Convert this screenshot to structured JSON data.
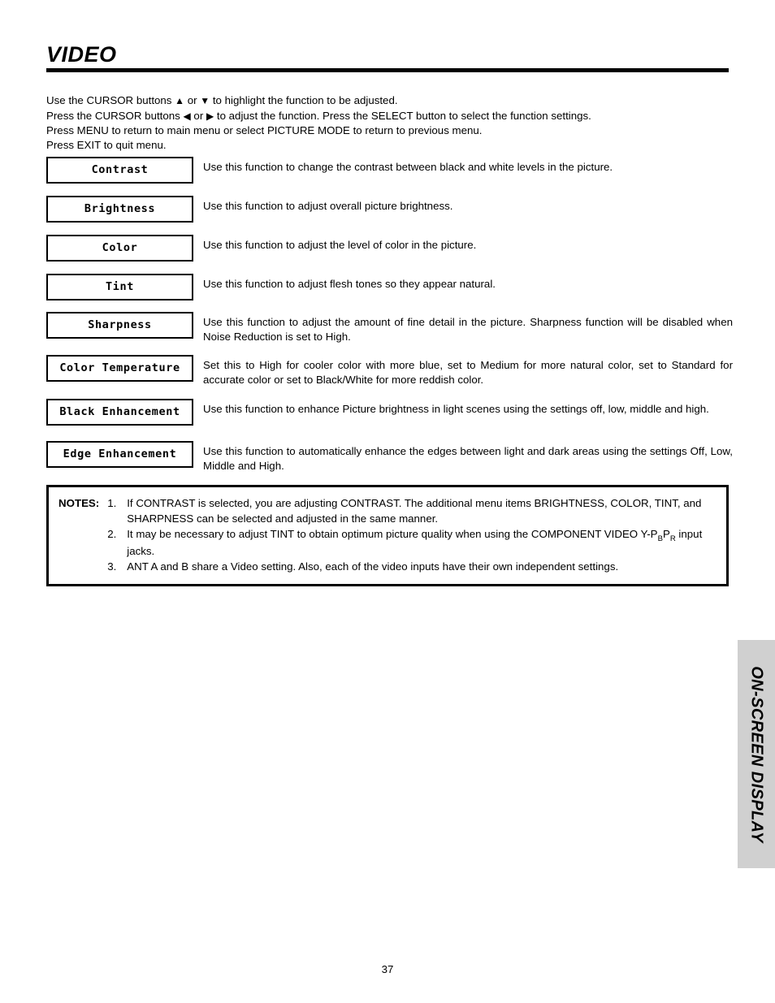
{
  "header": {
    "title": "VIDEO"
  },
  "intro": {
    "line1_a": "Use the CURSOR buttons ",
    "line1_up": "▲",
    "line1_b": " or ",
    "line1_down": "▼",
    "line1_c": " to highlight the function to be adjusted.",
    "line2_a": "Press the CURSOR buttons ",
    "line2_left": "◀",
    "line2_b": " or ",
    "line2_right": "▶",
    "line2_c": " to adjust the function.  Press the SELECT button to select the function settings.",
    "line3": "Press MENU to return to main menu or select PICTURE MODE to return to previous menu.",
    "line4": "Press EXIT to quit menu."
  },
  "functions": [
    {
      "label": "Contrast",
      "description": "Use this function to change the contrast between black and white levels in the picture."
    },
    {
      "label": "Brightness",
      "description": "Use this function to adjust overall picture brightness."
    },
    {
      "label": "Color",
      "description": "Use this function to adjust the level of color in the picture."
    },
    {
      "label": "Tint",
      "description": "Use this function to adjust flesh tones so they appear natural."
    },
    {
      "label": "Sharpness",
      "description": "Use this function to adjust the amount of fine detail in the picture.  Sharpness function will be disabled when Noise Reduction is set to High."
    },
    {
      "label": "Color Temperature",
      "description": "Set this to High for cooler color with more blue, set to Medium for more natural color, set to Standard for accurate color or set to Black/White for more reddish color."
    },
    {
      "label": "Black Enhancement",
      "description": "Use this function to enhance Picture brightness in light scenes using the settings off, low, middle and high."
    },
    {
      "label": "Edge Enhancement",
      "description": "Use this function to automatically enhance the edges between light and dark areas using the settings Off, Low, Middle and High."
    }
  ],
  "notes": {
    "label": "NOTES:",
    "items": [
      {
        "number": "1.",
        "text": "If CONTRAST is selected, you are adjusting CONTRAST.  The additional menu items BRIGHTNESS, COLOR, TINT, and SHARPNESS can be selected and adjusted in the same manner."
      },
      {
        "number": "2.",
        "text_before": "It may be necessary to adjust TINT to obtain optimum picture quality when using the COMPONENT VIDEO Y-P",
        "sub1": "B",
        "text_mid": "P",
        "sub2": "R",
        "text_after": " input jacks."
      },
      {
        "number": "3.",
        "text": "ANT A and B share a Video setting.  Also, each of the video inputs have their own independent settings."
      }
    ]
  },
  "side_tab": {
    "label": "ON-SCREEN DISPLAY",
    "background_color": "#d0d0d0"
  },
  "footer": {
    "page_number": "37"
  }
}
